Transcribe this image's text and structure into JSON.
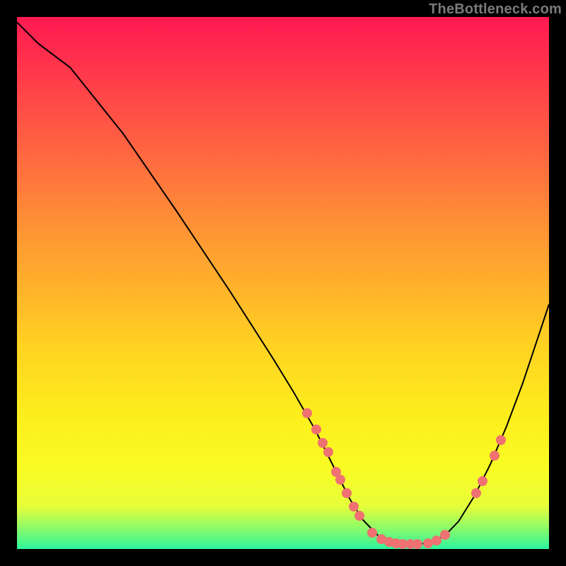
{
  "watermark": "TheBottleneck.com",
  "chart_data": {
    "type": "line",
    "title": "",
    "xlabel": "",
    "ylabel": "",
    "xlim": [
      0,
      100
    ],
    "ylim": [
      0,
      100
    ],
    "curve": [
      {
        "x": 0.0,
        "y": 99.0
      },
      {
        "x": 4.0,
        "y": 95.0
      },
      {
        "x": 10.0,
        "y": 90.5
      },
      {
        "x": 20.0,
        "y": 78.0
      },
      {
        "x": 30.0,
        "y": 63.5
      },
      {
        "x": 40.0,
        "y": 48.5
      },
      {
        "x": 48.0,
        "y": 36.0
      },
      {
        "x": 52.0,
        "y": 29.5
      },
      {
        "x": 56.0,
        "y": 22.5
      },
      {
        "x": 58.0,
        "y": 18.5
      },
      {
        "x": 60.0,
        "y": 14.5
      },
      {
        "x": 62.5,
        "y": 9.5
      },
      {
        "x": 65.0,
        "y": 5.5
      },
      {
        "x": 68.0,
        "y": 2.4
      },
      {
        "x": 70.5,
        "y": 1.3
      },
      {
        "x": 73.0,
        "y": 0.9
      },
      {
        "x": 75.5,
        "y": 0.9
      },
      {
        "x": 78.0,
        "y": 1.3
      },
      {
        "x": 80.5,
        "y": 2.6
      },
      {
        "x": 83.0,
        "y": 5.2
      },
      {
        "x": 86.0,
        "y": 10.0
      },
      {
        "x": 89.0,
        "y": 16.0
      },
      {
        "x": 92.0,
        "y": 23.0
      },
      {
        "x": 95.0,
        "y": 31.0
      },
      {
        "x": 98.0,
        "y": 40.0
      },
      {
        "x": 100.0,
        "y": 46.0
      }
    ],
    "points": [
      {
        "x": 54.5,
        "y": 25.5
      },
      {
        "x": 56.3,
        "y": 22.5
      },
      {
        "x": 57.5,
        "y": 20.0
      },
      {
        "x": 58.5,
        "y": 18.2
      },
      {
        "x": 60.0,
        "y": 14.5
      },
      {
        "x": 60.8,
        "y": 13.0
      },
      {
        "x": 62.0,
        "y": 10.5
      },
      {
        "x": 63.3,
        "y": 8.0
      },
      {
        "x": 64.3,
        "y": 6.3
      },
      {
        "x": 66.7,
        "y": 3.0
      },
      {
        "x": 68.5,
        "y": 1.9
      },
      {
        "x": 70.0,
        "y": 1.3
      },
      {
        "x": 71.3,
        "y": 1.0
      },
      {
        "x": 72.5,
        "y": 0.9
      },
      {
        "x": 74.0,
        "y": 0.9
      },
      {
        "x": 75.3,
        "y": 0.9
      },
      {
        "x": 77.3,
        "y": 1.1
      },
      {
        "x": 78.8,
        "y": 1.6
      },
      {
        "x": 80.5,
        "y": 2.6
      },
      {
        "x": 86.3,
        "y": 10.5
      },
      {
        "x": 87.5,
        "y": 12.8
      },
      {
        "x": 89.7,
        "y": 17.5
      },
      {
        "x": 91.0,
        "y": 20.5
      }
    ]
  },
  "colors": {
    "point_fill": "#ef7172",
    "curve_stroke": "#000000"
  }
}
